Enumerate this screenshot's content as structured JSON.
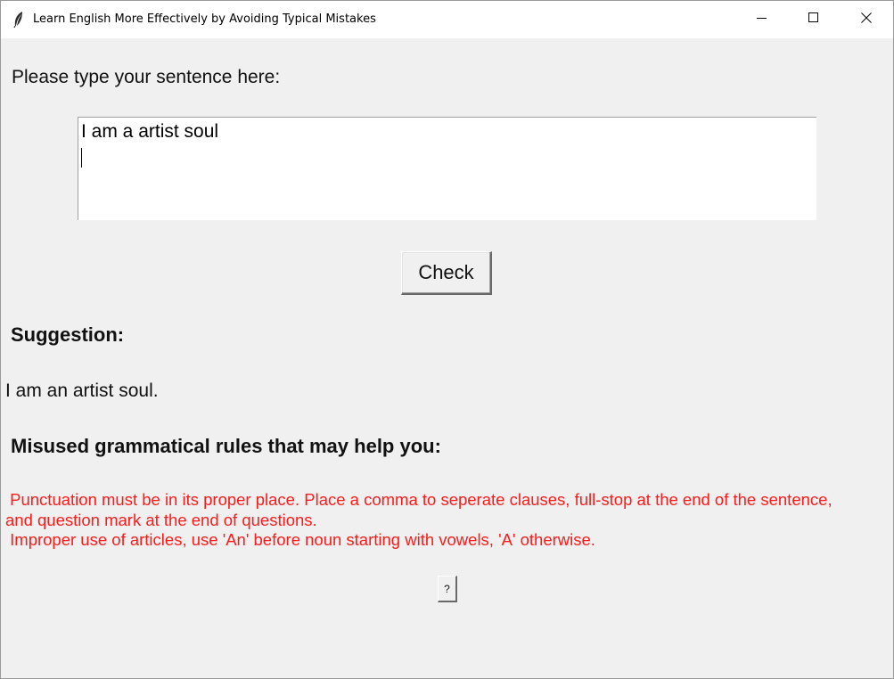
{
  "window": {
    "title": "Learn English More Effectively by Avoiding Typical Mistakes",
    "icons": {
      "app": "feather-icon",
      "minimize": "minimize-icon",
      "maximize": "maximize-icon",
      "close": "close-icon"
    }
  },
  "input": {
    "prompt_label": "Please type your sentence here:",
    "value": "I am a artist soul"
  },
  "actions": {
    "check_label": "Check",
    "help_label": "?"
  },
  "suggestion": {
    "heading": "Suggestion:",
    "text": "I am an artist soul."
  },
  "rules": {
    "heading": "Misused grammatical rules that may help you:",
    "color": "#ff1a1a",
    "lines": [
      " Punctuation must be in its proper place. Place a comma to seperate clauses, full-stop at the end of the sentence,",
      "and question mark at the end of questions.",
      " Improper use of articles, use 'An' before noun starting with vowels, 'A' otherwise."
    ]
  },
  "colors": {
    "background": "#f0f0f0",
    "titlebar": "#ffffff",
    "text": "#111111"
  }
}
